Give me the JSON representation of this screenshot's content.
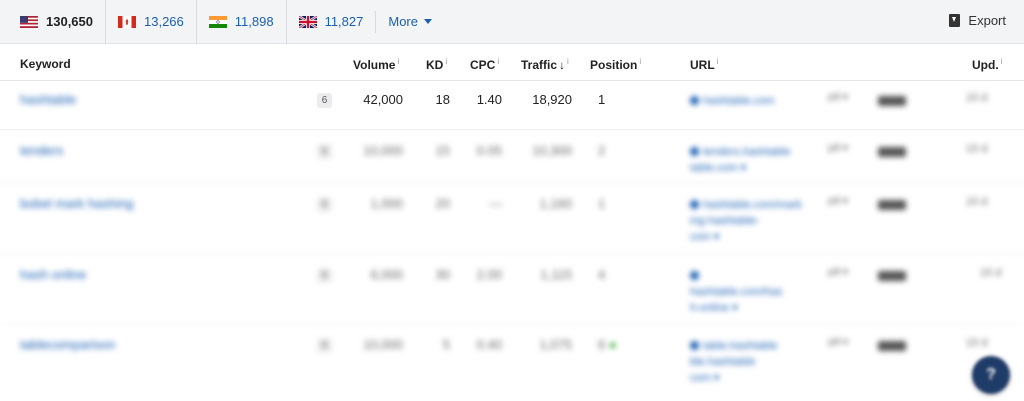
{
  "countries": [
    {
      "code": "us",
      "count": "130,650",
      "active": true
    },
    {
      "code": "ca",
      "count": "13,266"
    },
    {
      "code": "in",
      "count": "11,898"
    },
    {
      "code": "gb",
      "count": "11,827"
    }
  ],
  "more_label": "More",
  "export_label": "Export",
  "headers": {
    "keyword": "Keyword",
    "volume": "Volume",
    "kd": "KD",
    "cpc": "CPC",
    "traffic": "Traffic",
    "traffic_arrow": "↓",
    "position": "Position",
    "url": "URL",
    "updated": "Upd.",
    "info": "i"
  },
  "rows": [
    {
      "keyword": "hashtable",
      "serp": "6",
      "volume": "42,000",
      "kd": "18",
      "cpc": "1.40",
      "traffic": "18,920",
      "position": "1",
      "url": "hashtable.com",
      "url2": "",
      "url3": "",
      "extra": "pill ▾",
      "updated": "15 d"
    },
    {
      "keyword": "tenders",
      "serp": "6",
      "volume": "10,000",
      "kd": "15",
      "cpc": "0.05",
      "traffic": "10,300",
      "position": "2",
      "url": "tenders.hashtable",
      "url2": "table.com ▾",
      "url3": "",
      "extra": "pill ▾",
      "updated": "15 d"
    },
    {
      "keyword": "bobel mark hashing",
      "serp": "6",
      "volume": "1,000",
      "kd": "20",
      "cpc": "—",
      "traffic": "1,160",
      "position": "1",
      "url": "hashtable.com/mark",
      "url2": "ing-hashtable-",
      "url3": "com ▾",
      "extra": "pill ▾",
      "updated": "15 d"
    },
    {
      "keyword": "hash online",
      "serp": "6",
      "volume": "6,000",
      "kd": "30",
      "cpc": "2.00",
      "traffic": "1,115",
      "position": "4",
      "url": "",
      "url2": "hashtable.com/has",
      "url3": "h-online ▾",
      "extra": "pill ▾",
      "updated": "15 d"
    },
    {
      "keyword": "tablecomparison",
      "serp": "6",
      "volume": "10,000",
      "kd": "5",
      "cpc": "0.40",
      "traffic": "1,075",
      "position": "6",
      "url": "table.hashtable",
      "url2": "ble.hashtable",
      "url3": "com ▾",
      "extra": "pill ▾",
      "updated": "15 d"
    }
  ]
}
